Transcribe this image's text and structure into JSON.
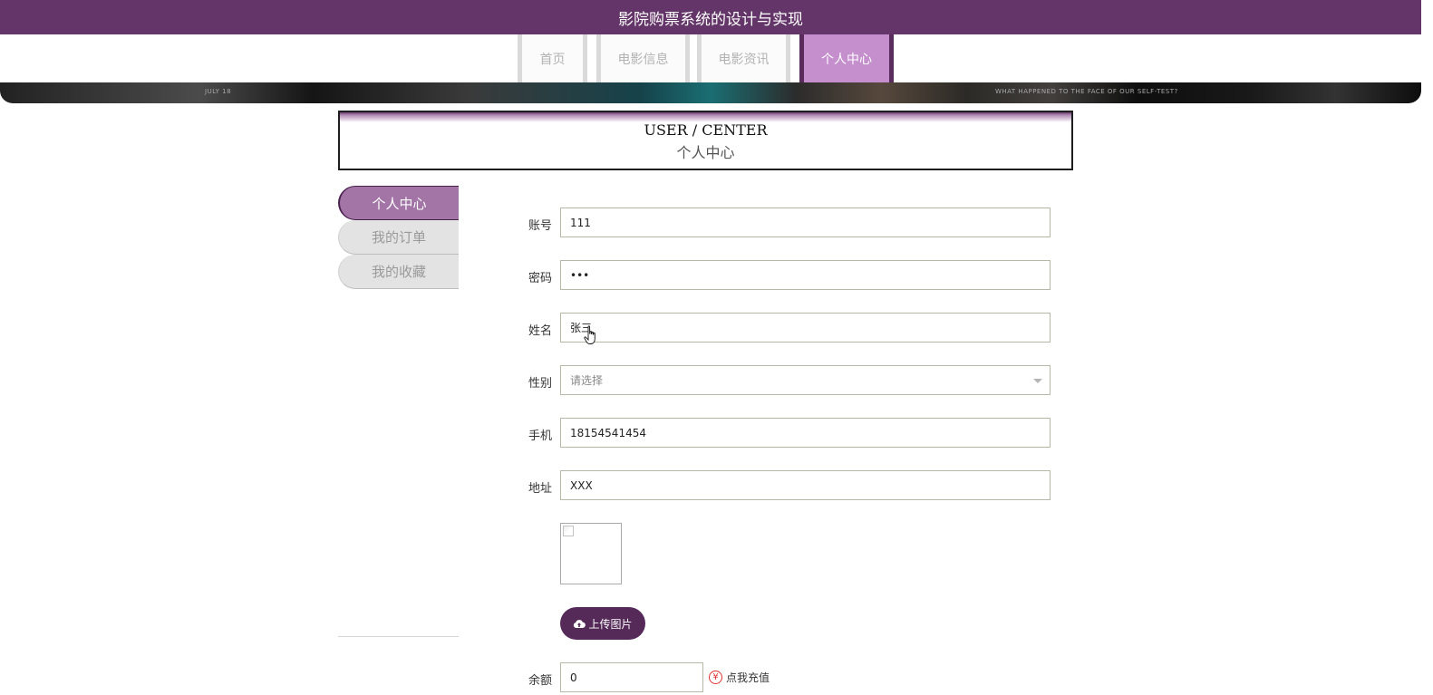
{
  "header": {
    "title": "影院购票系统的设计与实现"
  },
  "nav": {
    "tabs": [
      {
        "label": "首页"
      },
      {
        "label": "电影信息"
      },
      {
        "label": "电影资讯"
      },
      {
        "label": "个人中心"
      }
    ],
    "active_index": 3
  },
  "banner": {
    "text_left": "JULY 18",
    "text_right": "WHAT HAPPENED TO THE FACE OF OUR SELF-TEST?"
  },
  "user_center": {
    "title_en": "USER / CENTER",
    "title_cn": "个人中心"
  },
  "sidebar": {
    "items": [
      {
        "label": "个人中心"
      },
      {
        "label": "我的订单"
      },
      {
        "label": "我的收藏"
      }
    ],
    "active_index": 0
  },
  "form": {
    "account": {
      "label": "账号",
      "value": "111"
    },
    "password": {
      "label": "密码",
      "value": "•••"
    },
    "name": {
      "label": "姓名",
      "value": "张三"
    },
    "gender": {
      "label": "性别",
      "placeholder": "请选择"
    },
    "phone": {
      "label": "手机",
      "value": "18154541454"
    },
    "address": {
      "label": "地址",
      "value": "XXX"
    },
    "upload_button": "上传图片",
    "balance": {
      "label": "余额",
      "value": "0"
    },
    "recharge_link": "点我充值"
  },
  "colors": {
    "brand": "#643568",
    "nav_active": "#c48fcc",
    "sidebar_active": "#a275a6",
    "button": "#552a59",
    "recharge_icon": "#e23030"
  },
  "icons": {
    "upload": "cloud-upload-icon",
    "recharge": "yen-circle-icon",
    "select": "chevron-down-icon"
  }
}
